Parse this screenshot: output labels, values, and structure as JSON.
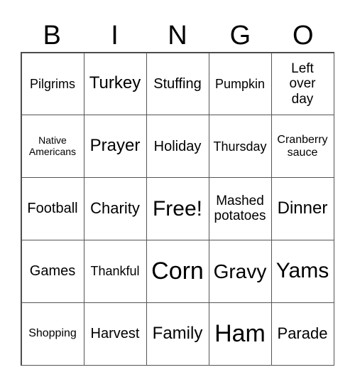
{
  "header": {
    "letters": [
      "B",
      "I",
      "N",
      "G",
      "O"
    ]
  },
  "cells": [
    [
      "Pilgrims",
      "Turkey",
      "Stuffing",
      "Pumpkin",
      "Left over day"
    ],
    [
      "Native Americans",
      "Prayer",
      "Holiday",
      "Thursday",
      "Cranberry sauce"
    ],
    [
      "Football",
      "Charity",
      "Free!",
      "Mashed potatoes",
      "Dinner"
    ],
    [
      "Games",
      "Thankful",
      "Corn",
      "Gravy",
      "Yams"
    ],
    [
      "Shopping",
      "Harvest",
      "Family",
      "Ham",
      "Parade"
    ]
  ]
}
